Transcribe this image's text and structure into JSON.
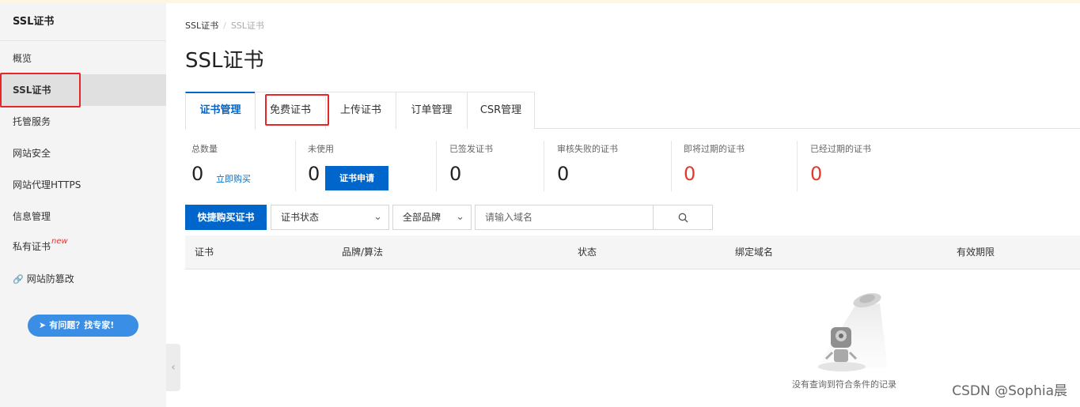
{
  "sidebar": {
    "title": "SSL证书",
    "items": [
      {
        "label": "概览"
      },
      {
        "label": "SSL证书"
      },
      {
        "label": "托管服务"
      },
      {
        "label": "网站安全"
      },
      {
        "label": "网站代理HTTPS"
      },
      {
        "label": "信息管理"
      },
      {
        "label": "私有证书",
        "badge": "new"
      },
      {
        "label": "网站防篡改",
        "icon": "link-icon"
      }
    ],
    "help_button": "有问题？找专家!"
  },
  "breadcrumb": {
    "root": "SSL证书",
    "separator": "/",
    "current": "SSL证书"
  },
  "page_title": "SSL证书",
  "tabs": [
    {
      "label": "证书管理",
      "active": true
    },
    {
      "label": "免费证书"
    },
    {
      "label": "上传证书"
    },
    {
      "label": "订单管理"
    },
    {
      "label": "CSR管理"
    }
  ],
  "stats": {
    "total": {
      "label": "总数量",
      "value": "0",
      "action": "立即购买"
    },
    "unused": {
      "label": "未使用",
      "value": "0",
      "action": "证书申请"
    },
    "issued": {
      "label": "已签发证书",
      "value": "0"
    },
    "failed": {
      "label": "审核失败的证书",
      "value": "0"
    },
    "expiring": {
      "label": "即将过期的证书",
      "value": "0"
    },
    "expired": {
      "label": "已经过期的证书",
      "value": "0"
    }
  },
  "toolbar": {
    "buy_button": "快捷购买证书",
    "status_select": "证书状态",
    "brand_select": "全部品牌",
    "search_placeholder": "请输入域名"
  },
  "table": {
    "headers": [
      "证书",
      "品牌/算法",
      "状态",
      "绑定域名",
      "有效期限"
    ],
    "empty_text": "没有查询到符合条件的记录"
  },
  "watermark": "CSDN @Sophia晨",
  "colors": {
    "primary": "#0066cc",
    "danger": "#e03c2d",
    "highlight": "#e6262a",
    "help": "#3a8ee6"
  }
}
